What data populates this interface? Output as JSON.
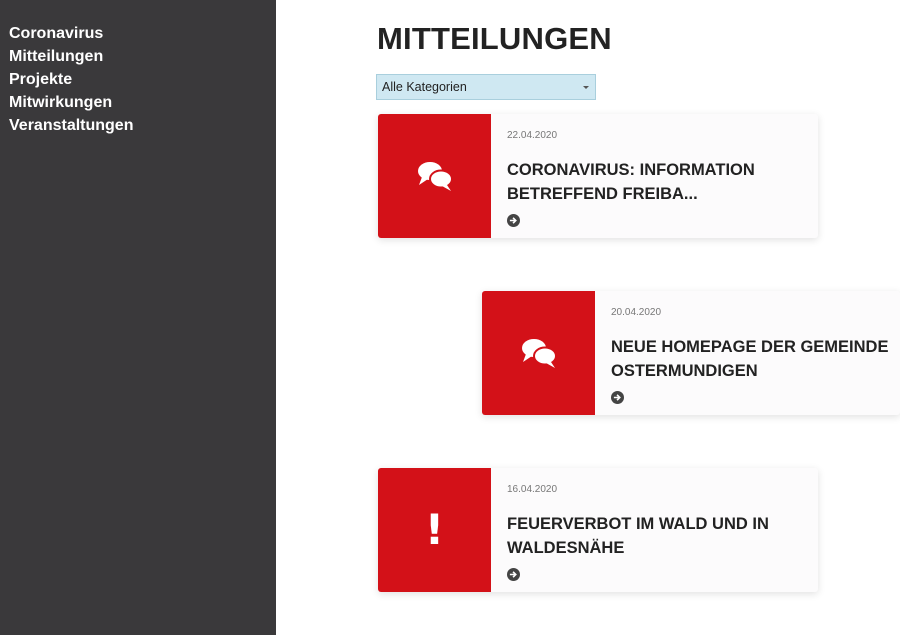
{
  "sidebar": {
    "items": [
      {
        "label": "Coronavirus"
      },
      {
        "label": "Mitteilungen"
      },
      {
        "label": "Projekte"
      },
      {
        "label": "Mitwirkungen"
      },
      {
        "label": "Veranstaltungen"
      }
    ]
  },
  "main": {
    "title": "MITTEILUNGEN",
    "filter": {
      "selected": "Alle Kategorien"
    },
    "posts": [
      {
        "date": "22.04.2020",
        "title": "CORONAVIRUS: INFORMATION BETREFFEND FREIBA...",
        "icon": "chat-bubbles-icon"
      },
      {
        "date": "20.04.2020",
        "title": "NEUE HOMEPAGE DER GEMEINDE OSTERMUNDIGEN",
        "icon": "chat-bubbles-icon"
      },
      {
        "date": "16.04.2020",
        "title": "FEUERVERBOT IM WALD UND IN WALDESNÄHE",
        "icon": "exclamation-icon"
      }
    ]
  },
  "colors": {
    "sidebar_bg": "#3a393b",
    "accent_red": "#d31118",
    "filter_bg": "#cfe8f2"
  }
}
